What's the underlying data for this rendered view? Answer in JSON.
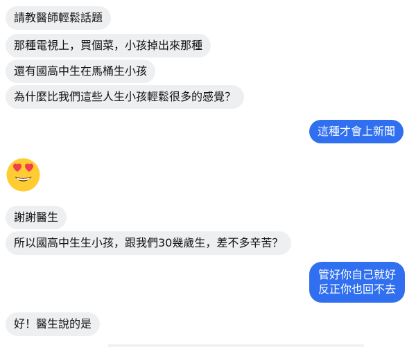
{
  "messages": [
    {
      "side": "in",
      "text": "請教醫師輕鬆話題"
    },
    {
      "side": "in",
      "text": "那種電視上，買個菜，小孩掉出來那種"
    },
    {
      "side": "in",
      "text": "還有國高中生在馬桶生小孩"
    },
    {
      "side": "in",
      "text": "為什麼比我們這些人生小孩輕鬆很多的感覺？"
    },
    {
      "side": "out",
      "text": "這種才會上新聞"
    },
    {
      "side": "in",
      "type": "emoji",
      "icon": "heart-eyes-emoji"
    },
    {
      "side": "in",
      "text": "謝謝醫生"
    },
    {
      "side": "in",
      "text": "所以國高中生生小孩，跟我們30幾歲生，差不多辛苦？"
    },
    {
      "side": "out",
      "lines": [
        "管好你自己就好",
        "反正你也回不去"
      ]
    },
    {
      "side": "in",
      "text": "好！醫生說的是"
    }
  ],
  "colors": {
    "incoming_bg": "#eeeff1",
    "outgoing_bg": "#2f6ff0",
    "emoji_face": "#ffcc33",
    "emoji_heart": "#f03e4f"
  }
}
